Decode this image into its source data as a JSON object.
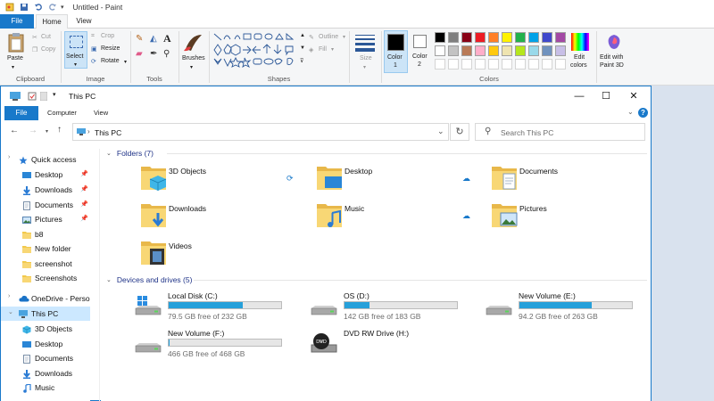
{
  "paint": {
    "title": "Untitled - Paint",
    "tabs": [
      "File",
      "Home",
      "View"
    ],
    "groups": {
      "clipboard": {
        "label": "Clipboard",
        "paste": "Paste",
        "cut": "Cut",
        "copy": "Copy"
      },
      "image": {
        "label": "Image",
        "select": "Select",
        "crop": "Crop",
        "resize": "Resize",
        "rotate": "Rotate"
      },
      "tools": {
        "label": "Tools"
      },
      "brushes": {
        "label": "Brushes"
      },
      "shapes": {
        "label": "Shapes",
        "outline": "Outline",
        "fill": "Fill"
      },
      "size": {
        "label": "Size"
      },
      "colors": {
        "label": "Colors",
        "color1": "Color",
        "color1_num": "1",
        "color2": "Color",
        "color2_num": "2",
        "edit_colors": "Edit",
        "edit_colors_2": "colors",
        "paint3d": "Edit with",
        "paint3d_2": "Paint 3D"
      }
    },
    "palette_row1": [
      "#000000",
      "#7f7f7f",
      "#880015",
      "#ed1c24",
      "#ff7f27",
      "#fff200",
      "#22b14c",
      "#00a2e8",
      "#3f48cc",
      "#a349a4"
    ],
    "palette_row2": [
      "#ffffff",
      "#c3c3c3",
      "#b97a57",
      "#ffaec9",
      "#ffc90e",
      "#efe4b0",
      "#b5e61d",
      "#99d9ea",
      "#7092be",
      "#c8bfe7"
    ],
    "color1_value": "#000000",
    "color2_value": "#ffffff"
  },
  "explorer": {
    "title": "This PC",
    "ribbon_tabs": [
      "File",
      "Computer",
      "View"
    ],
    "address": "This PC",
    "search_placeholder": "Search This PC",
    "nav": [
      {
        "label": "Quick access",
        "icon": "star-icon",
        "pinned": false
      },
      {
        "label": "Desktop",
        "icon": "desktop-icon",
        "pinned": true
      },
      {
        "label": "Downloads",
        "icon": "download-icon",
        "pinned": true
      },
      {
        "label": "Documents",
        "icon": "documents-icon",
        "pinned": true
      },
      {
        "label": "Pictures",
        "icon": "pictures-icon",
        "pinned": true
      },
      {
        "label": "b8",
        "icon": "folder-icon",
        "pinned": false
      },
      {
        "label": "New folder",
        "icon": "folder-icon",
        "pinned": false
      },
      {
        "label": "screenshot",
        "icon": "folder-icon",
        "pinned": false
      },
      {
        "label": "Screenshots",
        "icon": "folder-icon",
        "pinned": false
      },
      {
        "label": "OneDrive - Person",
        "icon": "cloud-icon",
        "pinned": false
      },
      {
        "label": "This PC",
        "icon": "computer-icon",
        "pinned": false
      },
      {
        "label": "3D Objects",
        "icon": "cube-icon",
        "pinned": false
      },
      {
        "label": "Desktop",
        "icon": "desktop-icon",
        "pinned": false
      },
      {
        "label": "Documents",
        "icon": "documents-icon",
        "pinned": false
      },
      {
        "label": "Downloads",
        "icon": "download-icon",
        "pinned": false
      },
      {
        "label": "Music",
        "icon": "music-icon",
        "pinned": false
      }
    ],
    "folders_header": "Folders (7)",
    "folders": [
      {
        "label": "3D Objects",
        "icon": "cube-folder-icon"
      },
      {
        "label": "Desktop",
        "icon": "desktop-folder-icon"
      },
      {
        "label": "Documents",
        "icon": "documents-folder-icon"
      },
      {
        "label": "Downloads",
        "icon": "downloads-folder-icon"
      },
      {
        "label": "Music",
        "icon": "music-folder-icon"
      },
      {
        "label": "Pictures",
        "icon": "pictures-folder-icon"
      },
      {
        "label": "Videos",
        "icon": "videos-folder-icon"
      }
    ],
    "drives_header": "Devices and drives (5)",
    "drives": [
      {
        "name": "Local Disk (C:)",
        "free": "79.5 GB free of 232 GB",
        "used_fraction": 0.66,
        "icon": "windows-drive-icon"
      },
      {
        "name": "OS (D:)",
        "free": "142 GB free of 183 GB",
        "used_fraction": 0.22,
        "icon": "drive-icon"
      },
      {
        "name": "New Volume (E:)",
        "free": "94.2 GB free of 263 GB",
        "used_fraction": 0.64,
        "icon": "drive-icon"
      },
      {
        "name": "New Volume (F:)",
        "free": "466 GB free of 468 GB",
        "used_fraction": 0.004,
        "icon": "drive-icon"
      },
      {
        "name": "DVD RW Drive (H:)",
        "free": "",
        "used_fraction": null,
        "icon": "dvd-drive-icon"
      }
    ],
    "dvd_label": "DVD"
  }
}
